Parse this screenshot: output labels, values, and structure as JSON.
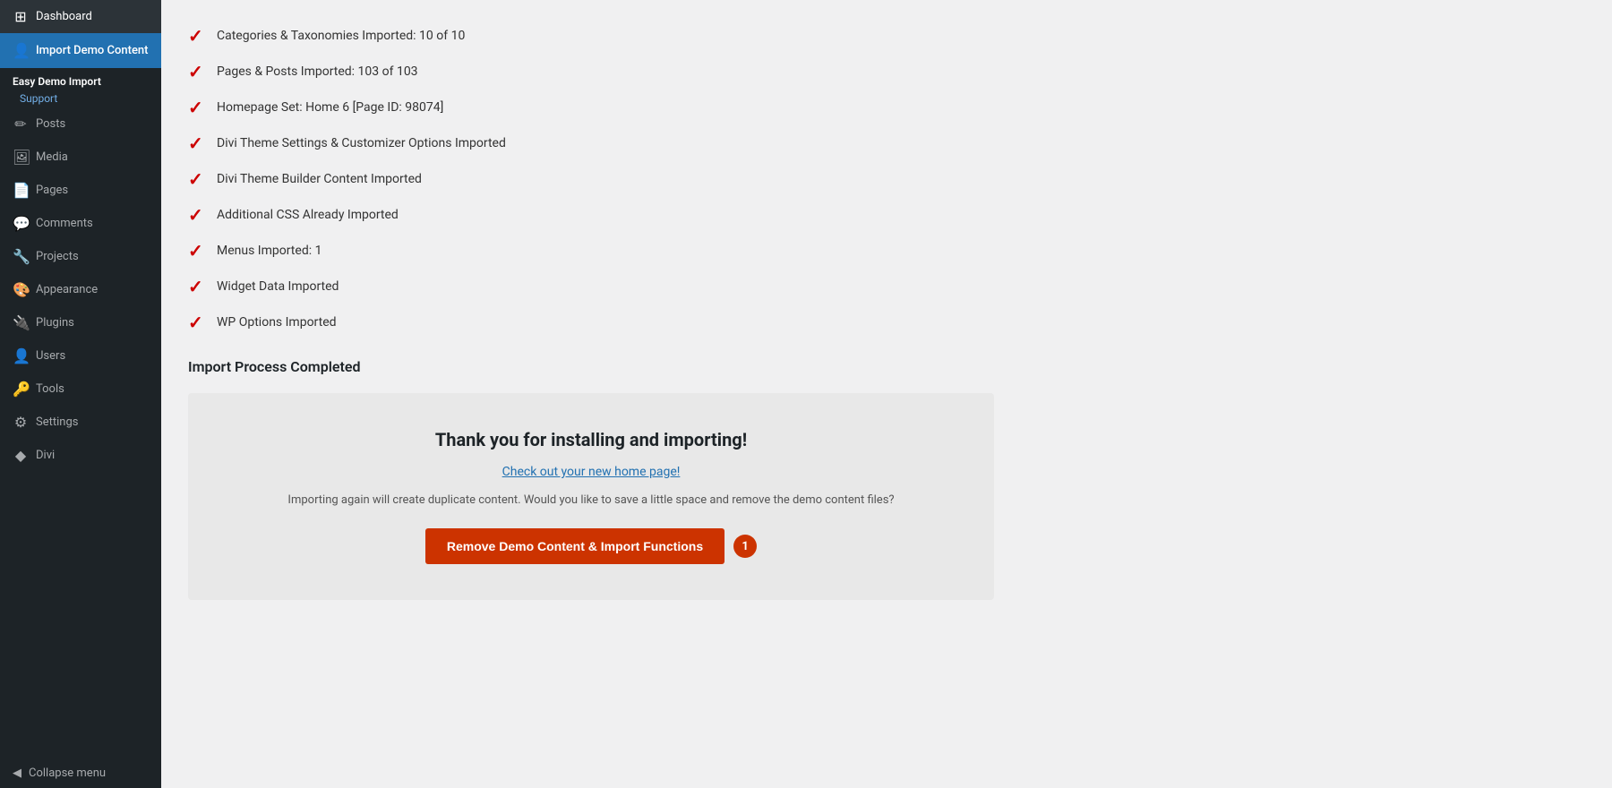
{
  "sidebar": {
    "logo": {
      "icon_char": "W",
      "label": "Dashboard"
    },
    "items": [
      {
        "id": "dashboard",
        "label": "Dashboard",
        "icon": "⊞",
        "active": false
      },
      {
        "id": "import-demo-content",
        "label": "Import Demo Content",
        "icon": "👤",
        "active": true
      },
      {
        "id": "easy-demo-import",
        "label": "Easy Demo Import",
        "icon": ""
      },
      {
        "id": "support",
        "label": "Support",
        "icon": ""
      },
      {
        "id": "posts",
        "label": "Posts",
        "icon": "✏"
      },
      {
        "id": "media",
        "label": "Media",
        "icon": "🖼"
      },
      {
        "id": "pages",
        "label": "Pages",
        "icon": "📄"
      },
      {
        "id": "comments",
        "label": "Comments",
        "icon": "💬"
      },
      {
        "id": "projects",
        "label": "Projects",
        "icon": "🔧"
      },
      {
        "id": "appearance",
        "label": "Appearance",
        "icon": "🎨"
      },
      {
        "id": "plugins",
        "label": "Plugins",
        "icon": "🔌"
      },
      {
        "id": "users",
        "label": "Users",
        "icon": "👤"
      },
      {
        "id": "tools",
        "label": "Tools",
        "icon": "🔑"
      },
      {
        "id": "settings",
        "label": "Settings",
        "icon": "⚙"
      },
      {
        "id": "divi",
        "label": "Divi",
        "icon": "◆"
      },
      {
        "id": "collapse",
        "label": "Collapse menu",
        "icon": "◀"
      }
    ]
  },
  "main": {
    "import_items": [
      {
        "id": "categories",
        "text": "Categories & Taxonomies Imported: 10 of 10"
      },
      {
        "id": "pages-posts",
        "text": "Pages & Posts Imported: 103 of 103"
      },
      {
        "id": "homepage",
        "text": "Homepage Set: Home 6 [Page ID: 98074]"
      },
      {
        "id": "divi-settings",
        "text": "Divi Theme Settings & Customizer Options Imported"
      },
      {
        "id": "divi-builder",
        "text": "Divi Theme Builder Content Imported"
      },
      {
        "id": "additional-css",
        "text": "Additional CSS Already Imported"
      },
      {
        "id": "menus",
        "text": "Menus Imported: 1"
      },
      {
        "id": "widget-data",
        "text": "Widget Data Imported"
      },
      {
        "id": "wp-options",
        "text": "WP Options Imported"
      }
    ],
    "completed_label": "Import Process Completed",
    "thank_you": {
      "title": "Thank you for installing and importing!",
      "link_text": "Check out your new home page!",
      "note": "Importing again will create duplicate content. Would you like to save a little space and remove the demo content files?",
      "button_label": "Remove Demo Content & Import Functions",
      "badge": "1"
    }
  }
}
